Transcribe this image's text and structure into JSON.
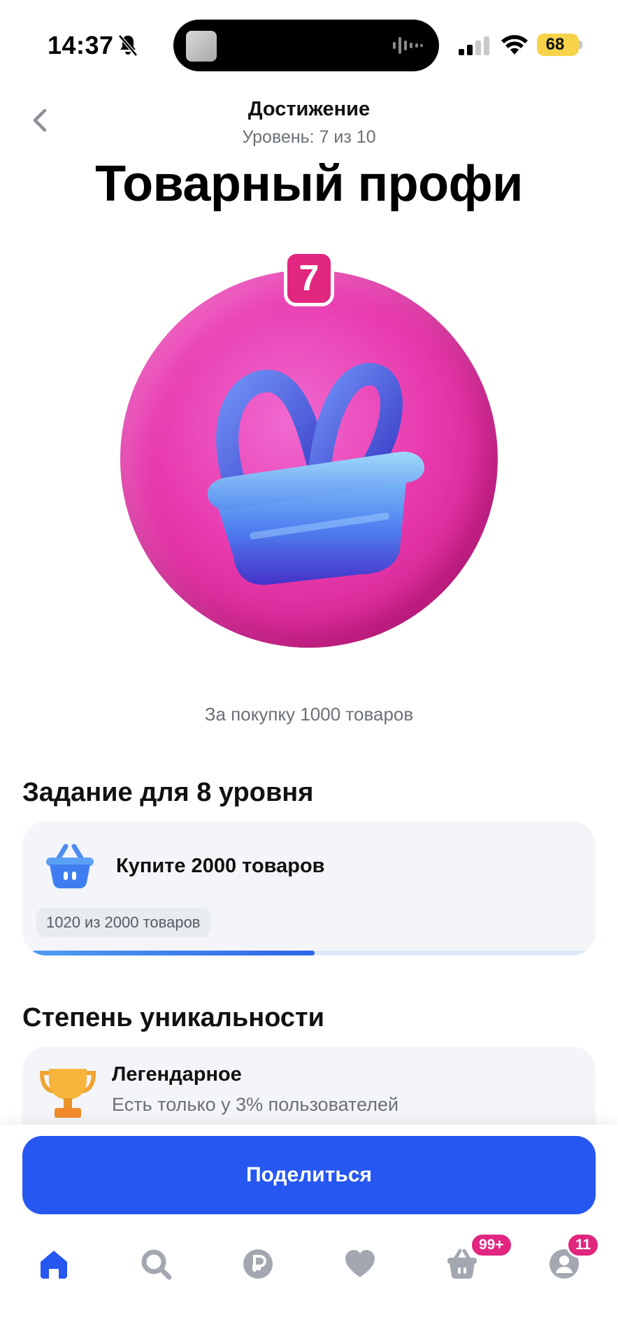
{
  "status_bar": {
    "time": "14:37",
    "battery": "68"
  },
  "header": {
    "title": "Достижение",
    "subtitle": "Уровень: 7 из 10"
  },
  "page_title": "Товарный профи",
  "badge": {
    "level": "7",
    "caption": "За покупку 1000 товаров"
  },
  "task": {
    "section_title": "Задание для 8 уровня",
    "label": "Купите 2000 товаров",
    "progress_text": "1020 из 2000 товаров",
    "progress_fraction": 0.51
  },
  "rarity": {
    "section_title": "Степень уникальности",
    "title": "Легендарное",
    "description": "Есть только у 3% пользователей"
  },
  "share_button": "Поделиться",
  "tabs": [
    {
      "name": "home",
      "icon": "home-icon",
      "active": true
    },
    {
      "name": "search",
      "icon": "search-icon"
    },
    {
      "name": "payments",
      "icon": "ruble-icon"
    },
    {
      "name": "favorites",
      "icon": "heart-icon"
    },
    {
      "name": "cart",
      "icon": "cart-icon",
      "badge": "99+"
    },
    {
      "name": "profile",
      "icon": "profile-icon",
      "badge": "11"
    }
  ],
  "colors": {
    "accent": "#2657f0",
    "badge_pink": "#e0267f",
    "active_tab": "#2657f0",
    "inactive_tab": "#a3a8b0"
  }
}
